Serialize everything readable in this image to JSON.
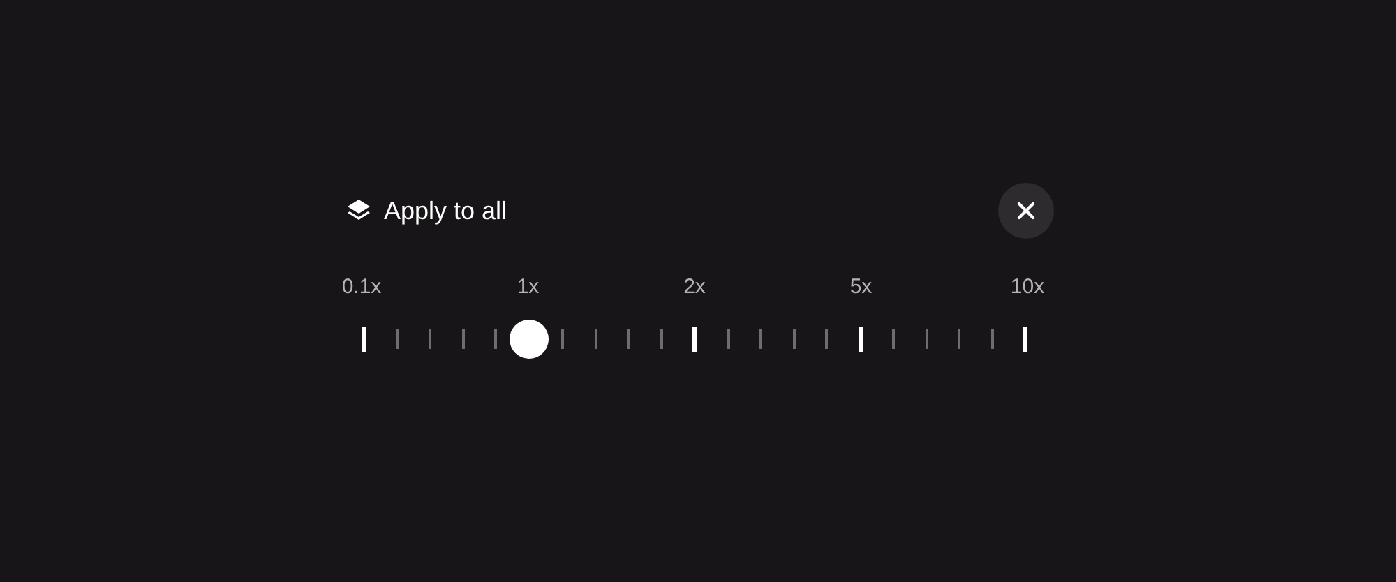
{
  "header": {
    "title": "Apply to all"
  },
  "speed_slider": {
    "level": 0.25,
    "labels": [
      "0.1x",
      "1x",
      "2x",
      "5x",
      "10x"
    ]
  }
}
